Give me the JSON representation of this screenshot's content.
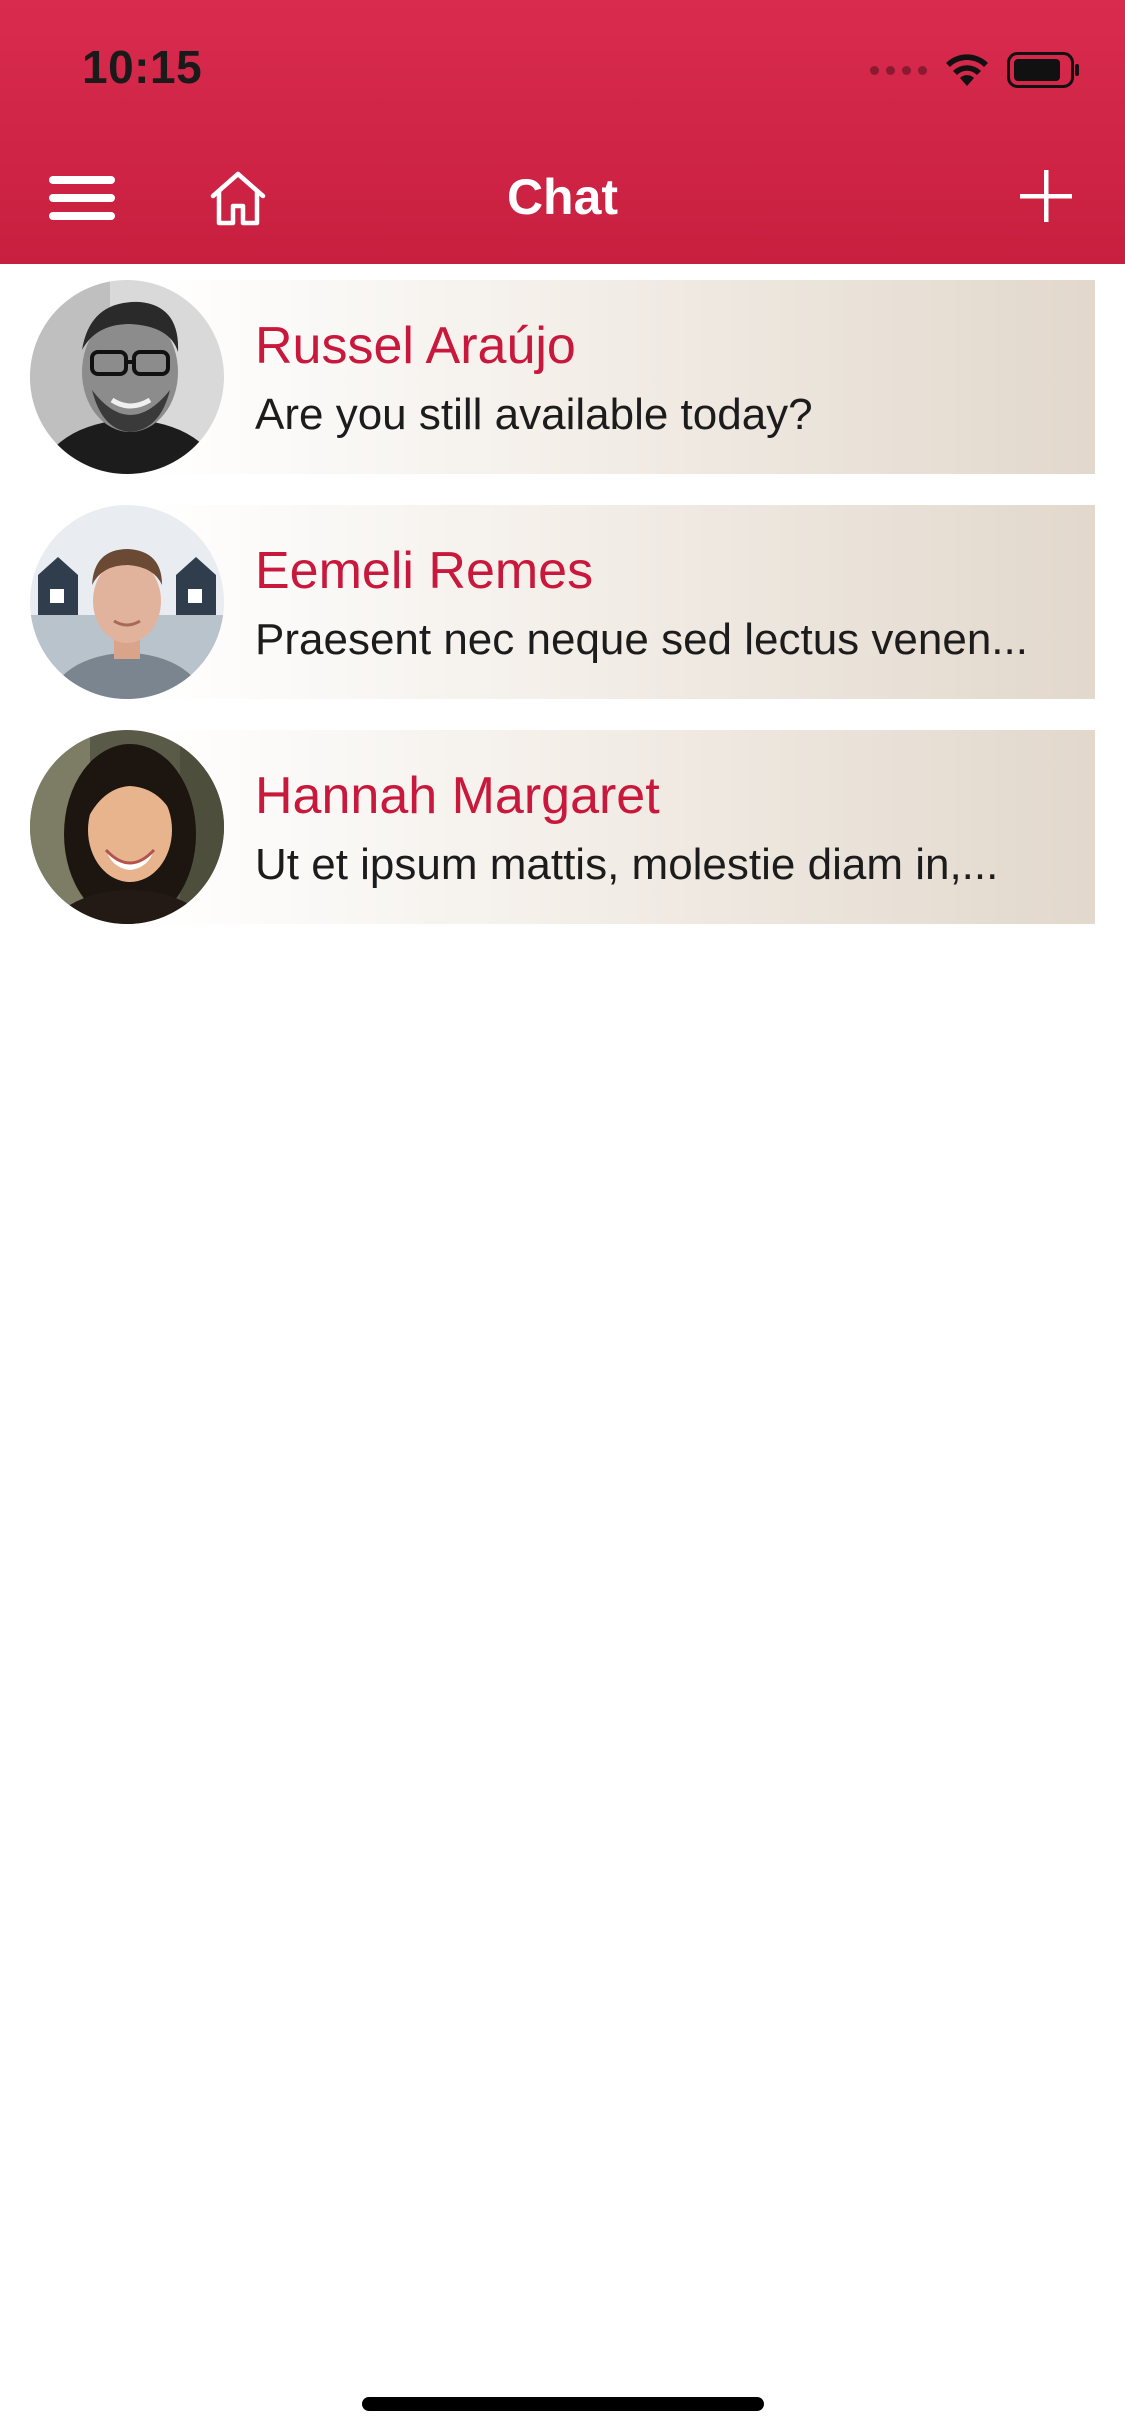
{
  "status_bar": {
    "time": "10:15"
  },
  "nav": {
    "title": "Chat",
    "menu_icon": "hamburger-menu-icon",
    "home_icon": "home-icon",
    "add_icon": "plus-icon"
  },
  "colors": {
    "brand": "#c81f3f",
    "name_text": "#c8183c",
    "card_end": "#e2d8cc"
  },
  "chats": [
    {
      "name": "Russel Araújo",
      "message": "Are you still available today?",
      "avatar_icon": "avatar-man-glasses"
    },
    {
      "name": "Eemeli Remes",
      "message": "Praesent nec neque sed lectus venen...",
      "avatar_icon": "avatar-young-man"
    },
    {
      "name": "Hannah Margaret",
      "message": "Ut et ipsum mattis, molestie diam in,...",
      "avatar_icon": "avatar-woman"
    }
  ]
}
